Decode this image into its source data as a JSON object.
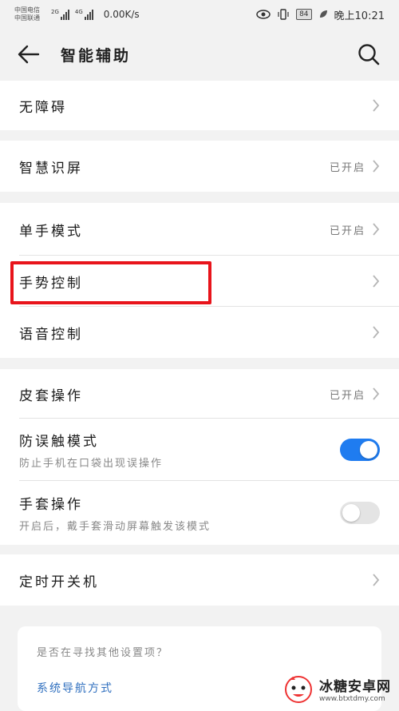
{
  "status_bar": {
    "carrier1": "中国电信",
    "carrier2": "中国联通",
    "net1": "2G",
    "net2": "4G",
    "speed": "0.00K/s",
    "battery": "84",
    "time": "晚上10:21"
  },
  "header": {
    "title": "智能辅助",
    "back_icon": "arrow-left-icon",
    "search_icon": "search-icon"
  },
  "groups": [
    {
      "rows": [
        {
          "label": "无障碍",
          "status": ""
        }
      ]
    },
    {
      "rows": [
        {
          "label": "智慧识屏",
          "status": "已开启"
        }
      ]
    },
    {
      "rows": [
        {
          "label": "单手模式",
          "status": "已开启"
        },
        {
          "label": "手势控制",
          "status": ""
        },
        {
          "label": "语音控制",
          "status": ""
        }
      ]
    },
    {
      "rows": [
        {
          "label": "皮套操作",
          "status": "已开启"
        },
        {
          "label": "防误触模式",
          "sub": "防止手机在口袋出现误操作",
          "toggle": true
        },
        {
          "label": "手套操作",
          "sub": "开启后，戴手套滑动屏幕触发该模式",
          "toggle": false
        }
      ]
    },
    {
      "rows": [
        {
          "label": "定时开关机",
          "status": ""
        }
      ]
    }
  ],
  "suggestion": {
    "question": "是否在寻找其他设置项？",
    "link": "系统导航方式"
  },
  "watermark": {
    "title": "冰糖安卓网",
    "url": "www.btxtdmy.com"
  },
  "colors": {
    "accent": "#1f7cf0",
    "highlight": "#e8141b",
    "link": "#2f6fbf"
  }
}
